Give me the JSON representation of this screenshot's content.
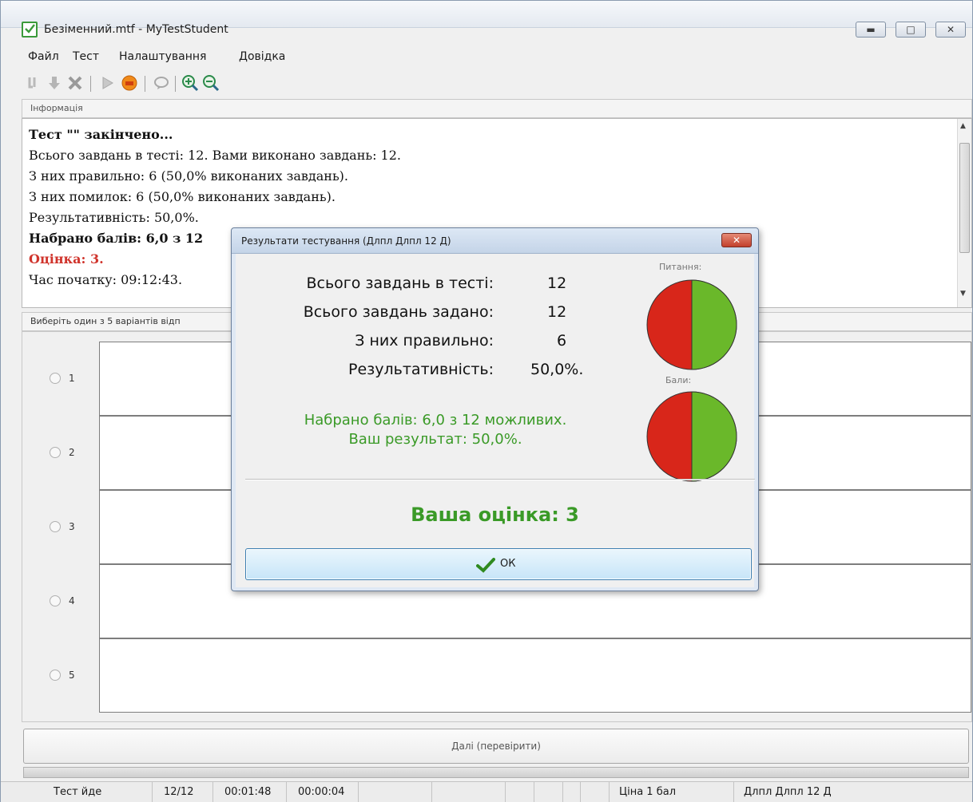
{
  "window": {
    "title": "Безіменний.mtf - MyTestStudent"
  },
  "menu": [
    "Файл",
    "Тест",
    "Налаштування",
    "Довідка"
  ],
  "info": {
    "header": "Інформація",
    "lines": [
      "Тест \"\" закінчено...",
      "Всього завдань в тесті: 12. Вами виконано завдань: 12.",
      "З них правильно: 6 (50,0% виконаних завдань).",
      "З них помилок: 6 (50,0% виконаних завдань).",
      "Результативність: 50,0%.",
      "Набрано балів: 6,0 з 12",
      "Оцінка: 3.",
      "Час початку: 09:12:43."
    ]
  },
  "question": {
    "header": "Виберіть один з 5 варіантів відп",
    "answers": [
      "1",
      "2",
      "3",
      "4",
      "5"
    ]
  },
  "next_button": "Далі (перевірити)",
  "status": {
    "state": "Тест йде",
    "progress": "12/12",
    "elapsed": "00:01:48",
    "task_time": "00:00:04",
    "price": "Ціна 1 бал",
    "student": "Длпл Длпл 12 Д"
  },
  "dialog": {
    "title": "Результати тестування (Длпл Длпл 12 Д)",
    "stats": [
      {
        "label": "Всього завдань в тесті:",
        "value": "12"
      },
      {
        "label": "Всього завдань задано:",
        "value": "12"
      },
      {
        "label": "З них правильно:",
        "value": "6"
      },
      {
        "label": "Результативність:",
        "value": "50,0%."
      }
    ],
    "score_line": "Набрано балів: 6,0 з 12 можливих.",
    "result_line": "Ваш результат: 50,0%.",
    "grade": "Ваша оцінка: 3",
    "ok": "ОК",
    "pie_questions": {
      "caption": "Питання:",
      "correct_fraction": 0.5
    },
    "pie_points": {
      "caption": "Бали:",
      "correct_fraction": 0.5
    },
    "colors": {
      "correct": "#6ab82a",
      "wrong": "#d8261a"
    }
  }
}
